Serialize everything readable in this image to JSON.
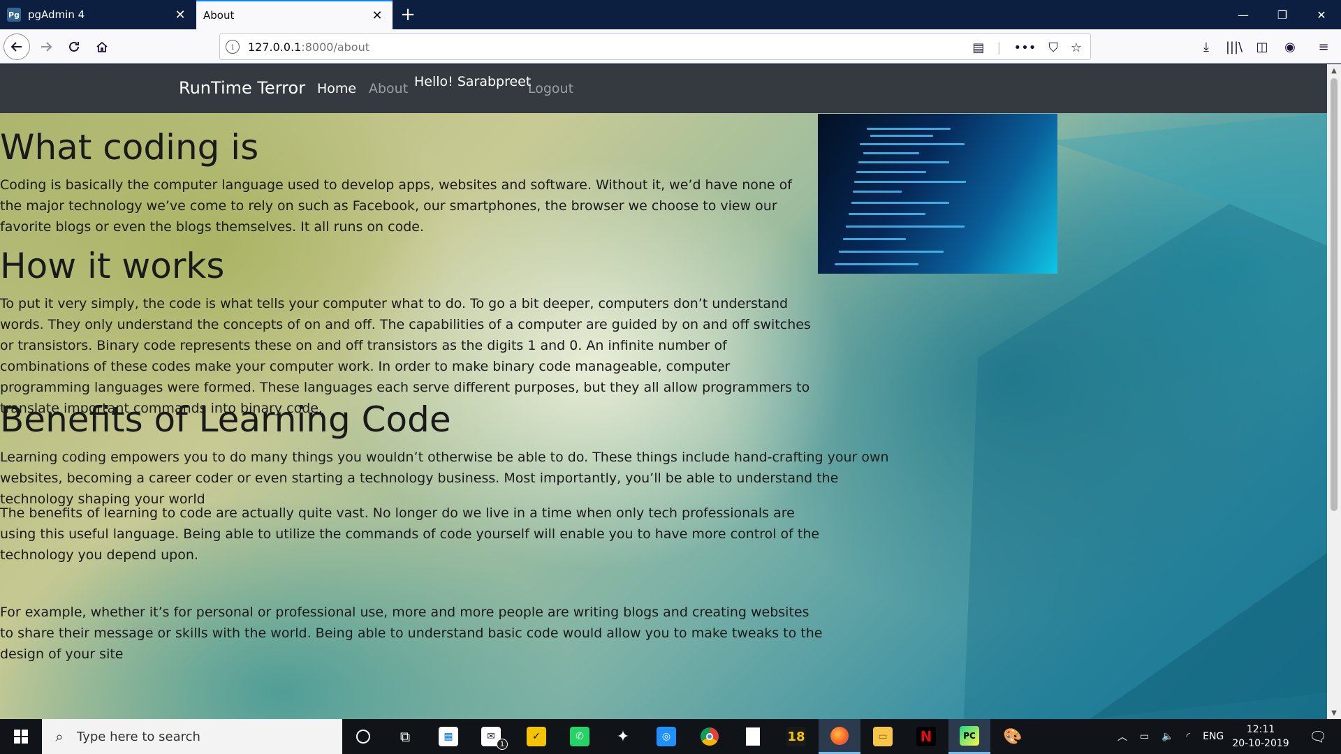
{
  "browser": {
    "tabs": [
      {
        "title": "pgAdmin 4",
        "favicon": "Pg",
        "active": false
      },
      {
        "title": "About",
        "active": true
      }
    ],
    "url_host": "127.0.0.1",
    "url_path": ":8000/about"
  },
  "site": {
    "brand": "RunTime Terror",
    "nav": {
      "home": "Home",
      "about": "About",
      "hello": "Hello! Sarabpreet",
      "logout": "Logout"
    }
  },
  "content": {
    "section1_title": "What coding is",
    "section1_text": "Coding is basically the computer language used to develop apps, websites and software. Without it, we’d have none of the major technology we’ve come to rely on such as Facebook, our smartphones, the browser we choose to view our favorite blogs or even the blogs themselves. It all runs on code.",
    "section2_title": "How it works",
    "section2_text": "To put it very simply, the code is what tells your computer what to do. To go a bit deeper, computers don’t understand words. They only understand the concepts of on and off. The capabilities of a computer are guided by on and off switches or transistors. Binary code represents these on and off transistors as the digits 1 and 0. An infinite number of combinations of these codes make your computer work. In order to make binary code manageable, computer programming languages were formed. These languages each serve different purposes, but they all allow programmers to translate important commands into binary code.",
    "section3_title": "Benefits of Learning Code",
    "section3_p1": "Learning coding empowers you to do many things you wouldn’t otherwise be able to do. These things include hand-crafting your own websites, becoming a career coder or even starting a technology business. Most importantly, you’ll be able to understand the technology shaping your world",
    "section3_p2": "The benefits of learning to code are actually quite vast. No longer do we live in a time when only tech professionals are using this useful language. Being able to utilize the commands of code yourself will enable you to have more control of the technology you depend upon.",
    "section3_p3": "For example, whether it’s for personal or professional use, more and more people are writing blogs and creating websites to share their message or skills with the world. Being able to understand basic code would allow you to make tweaks to the design of your site"
  },
  "taskbar": {
    "search_placeholder": "Type here to search",
    "mail_badge": "1",
    "app18_label": "18",
    "lang": "ENG",
    "time": "12:11",
    "date": "20-10-2019"
  },
  "colors": {
    "tabstrip": "#0c1f40",
    "site_nav": "#343a40",
    "accent": "#0a84ff"
  }
}
